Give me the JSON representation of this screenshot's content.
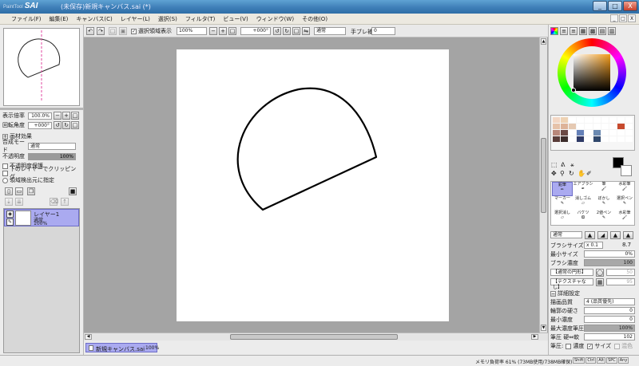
{
  "window": {
    "logo": "SAI",
    "logo_prefix": "PaintTool",
    "title": "(未保存)新規キャンバス.sai (*)",
    "min_label": "_",
    "max_label": "□",
    "close_label": "X"
  },
  "menu": {
    "items": [
      "ファイル(F)",
      "編集(E)",
      "キャンバス(C)",
      "レイヤー(L)",
      "選択(S)",
      "フィルタ(T)",
      "ビュー(V)",
      "ウィンドウ(W)",
      "その他(O)"
    ],
    "right_buttons": [
      "_",
      "□",
      "X"
    ]
  },
  "left_panel": {
    "zoom_label": "表示倍率",
    "zoom_value": "100.0%",
    "rotate_label": "回転角度",
    "rotate_value": "+000°",
    "effects_label": "画材効果",
    "blend_mode_label": "合成モード",
    "blend_mode_value": "通常",
    "opacity_label": "不透明度",
    "opacity_value": "100%",
    "check_preserve_opacity": "不透明度保護",
    "check_clip_lower": "下のレイヤーでクリッピング",
    "check_select_source": "領域検出元に指定",
    "layer": {
      "name": "レイヤー1",
      "mode": "通常",
      "opacity": "100%"
    }
  },
  "toolbar": {
    "show_selection_label": "選択領域表示",
    "zoom_value": "100%",
    "angle_value": "+000°",
    "blend_mode": "通常",
    "stabilizer_label": "手ブレ補正",
    "stabilizer_value": "0"
  },
  "doc_tab": {
    "name": "新規キャンバス.sai",
    "zoom": "100%"
  },
  "right_panel": {
    "foreground_color": "#000000",
    "tools": [
      [
        "鉛筆",
        "エアブラシ",
        "筆",
        "水彩筆"
      ],
      [
        "マーカー",
        "消しゴム",
        "ぼかし",
        "選択ペン"
      ],
      [
        "選択消し",
        "バケツ",
        "2値ペン",
        "水彩筆"
      ]
    ],
    "brush_mode": "通常",
    "brush_size_label": "ブラシサイズ",
    "brush_size_mult": "x 0.1",
    "brush_size_value": "8.7",
    "min_size_label": "最小サイズ",
    "min_size_value": "0%",
    "density_label": "ブラシ濃度",
    "density_value": "100",
    "shape_label": "【通常の円形】",
    "texture_label": "【テクスチャなし】",
    "shape_amount": "50",
    "texture_amount": "95",
    "detail_label": "詳細設定",
    "quality_label": "描画品質",
    "quality_value": "4 (品質優先)",
    "edge_label": "輪郭の硬さ",
    "edge_value": "0",
    "min_density_label": "最小濃度",
    "min_density_value": "0",
    "max_pressure_label": "最大濃度筆圧",
    "max_pressure_value": "100%",
    "pressure_hard_label": "筆圧 硬⇔軟",
    "pressure_hard_value": "102",
    "pressure_label": "筆圧:",
    "pressure_density": "濃度",
    "pressure_size": "サイズ",
    "pressure_blend": "混色"
  },
  "status": {
    "memory": "メモリ負荷率 61% (73MB使用/738MB確保)",
    "keys": [
      "Shift",
      "Ctrl",
      "Alt",
      "SPC",
      "Any"
    ]
  },
  "colors": {
    "accent": "#aaaaf0",
    "canvas_bg": "#a4a4a4",
    "title_bg": "#3f7fb8"
  }
}
